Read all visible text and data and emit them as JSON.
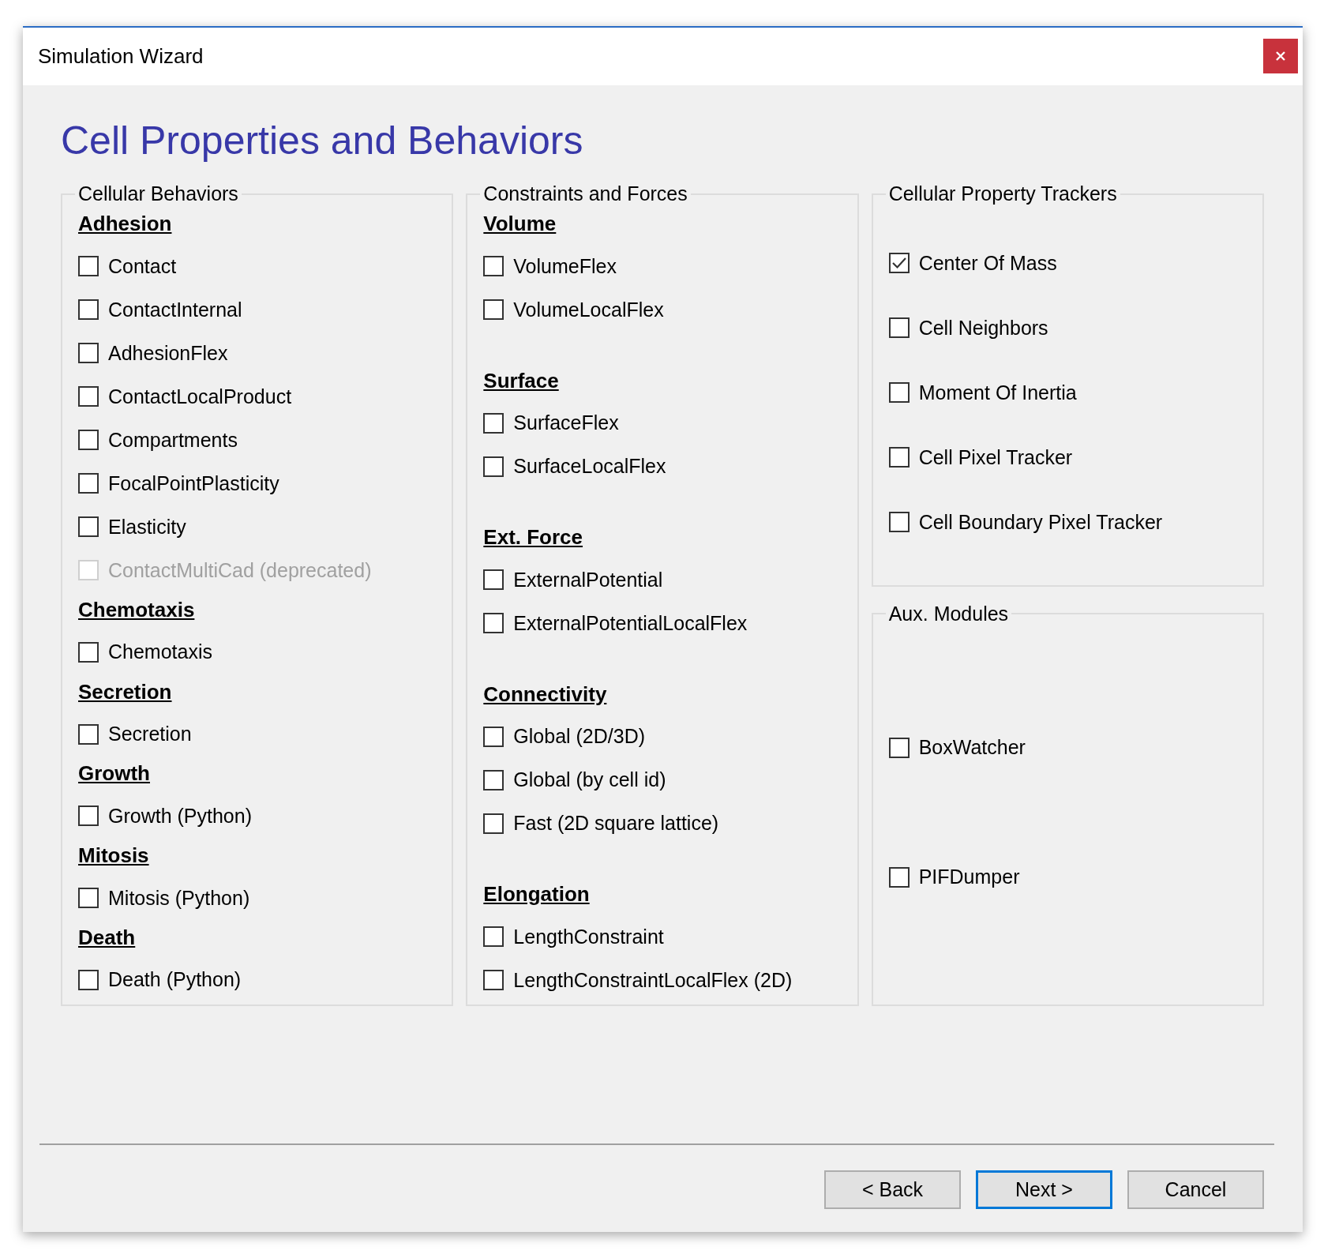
{
  "window": {
    "title": "Simulation Wizard"
  },
  "page_title": "Cell Properties and Behaviors",
  "groups": [
    {
      "title": "Cellular Behaviors",
      "sections": [
        {
          "heading": "Adhesion",
          "options": [
            {
              "label": "Contact",
              "checked": false,
              "disabled": false
            },
            {
              "label": "ContactInternal",
              "checked": false,
              "disabled": false
            },
            {
              "label": "AdhesionFlex",
              "checked": false,
              "disabled": false
            },
            {
              "label": "ContactLocalProduct",
              "checked": false,
              "disabled": false
            },
            {
              "label": "Compartments",
              "checked": false,
              "disabled": false
            },
            {
              "label": "FocalPointPlasticity",
              "checked": false,
              "disabled": false
            },
            {
              "label": "Elasticity",
              "checked": false,
              "disabled": false
            },
            {
              "label": "ContactMultiCad (deprecated)",
              "checked": false,
              "disabled": true
            }
          ]
        },
        {
          "heading": "Chemotaxis",
          "options": [
            {
              "label": "Chemotaxis",
              "checked": false,
              "disabled": false
            }
          ]
        },
        {
          "heading": "Secretion",
          "options": [
            {
              "label": "Secretion",
              "checked": false,
              "disabled": false
            }
          ]
        },
        {
          "heading": "Growth",
          "options": [
            {
              "label": "Growth (Python)",
              "checked": false,
              "disabled": false
            }
          ]
        },
        {
          "heading": "Mitosis",
          "options": [
            {
              "label": "Mitosis (Python)",
              "checked": false,
              "disabled": false
            }
          ]
        },
        {
          "heading": "Death",
          "options": [
            {
              "label": "Death (Python)",
              "checked": false,
              "disabled": false
            }
          ]
        }
      ]
    },
    {
      "title": "Constraints and Forces",
      "sections": [
        {
          "heading": "Volume",
          "options": [
            {
              "label": "VolumeFlex",
              "checked": false,
              "disabled": false
            },
            {
              "label": "VolumeLocalFlex",
              "checked": false,
              "disabled": false
            }
          ]
        },
        {
          "heading": "Surface",
          "options": [
            {
              "label": "SurfaceFlex",
              "checked": false,
              "disabled": false
            },
            {
              "label": "SurfaceLocalFlex",
              "checked": false,
              "disabled": false
            }
          ]
        },
        {
          "heading": "Ext. Force",
          "options": [
            {
              "label": "ExternalPotential",
              "checked": false,
              "disabled": false
            },
            {
              "label": "ExternalPotentialLocalFlex",
              "checked": false,
              "disabled": false
            }
          ]
        },
        {
          "heading": "Connectivity",
          "options": [
            {
              "label": "Global (2D/3D)",
              "checked": false,
              "disabled": false
            },
            {
              "label": "Global (by cell id)",
              "checked": false,
              "disabled": false
            },
            {
              "label": "Fast (2D square lattice)",
              "checked": false,
              "disabled": false
            }
          ]
        },
        {
          "heading": "Elongation",
          "options": [
            {
              "label": "LengthConstraint",
              "checked": false,
              "disabled": false
            },
            {
              "label": "LengthConstraintLocalFlex (2D)",
              "checked": false,
              "disabled": false
            }
          ]
        }
      ]
    },
    {
      "title": "Cellular Property Trackers",
      "sections": [
        {
          "options": [
            {
              "label": "Center Of Mass",
              "checked": true,
              "disabled": false
            },
            {
              "label": "Cell Neighbors",
              "checked": false,
              "disabled": false
            },
            {
              "label": "Moment Of Inertia",
              "checked": false,
              "disabled": false
            },
            {
              "label": "Cell Pixel Tracker",
              "checked": false,
              "disabled": false
            },
            {
              "label": "Cell Boundary Pixel Tracker",
              "checked": false,
              "disabled": false
            }
          ]
        }
      ]
    },
    {
      "title": "Aux. Modules",
      "sections": [
        {
          "options": [
            {
              "label": "BoxWatcher",
              "checked": false,
              "disabled": false
            },
            {
              "label": "PIFDumper",
              "checked": false,
              "disabled": false
            }
          ]
        }
      ]
    }
  ],
  "buttons": [
    {
      "label": "< Back",
      "default": false
    },
    {
      "label": "Next >",
      "default": true
    },
    {
      "label": "Cancel",
      "default": false
    }
  ]
}
